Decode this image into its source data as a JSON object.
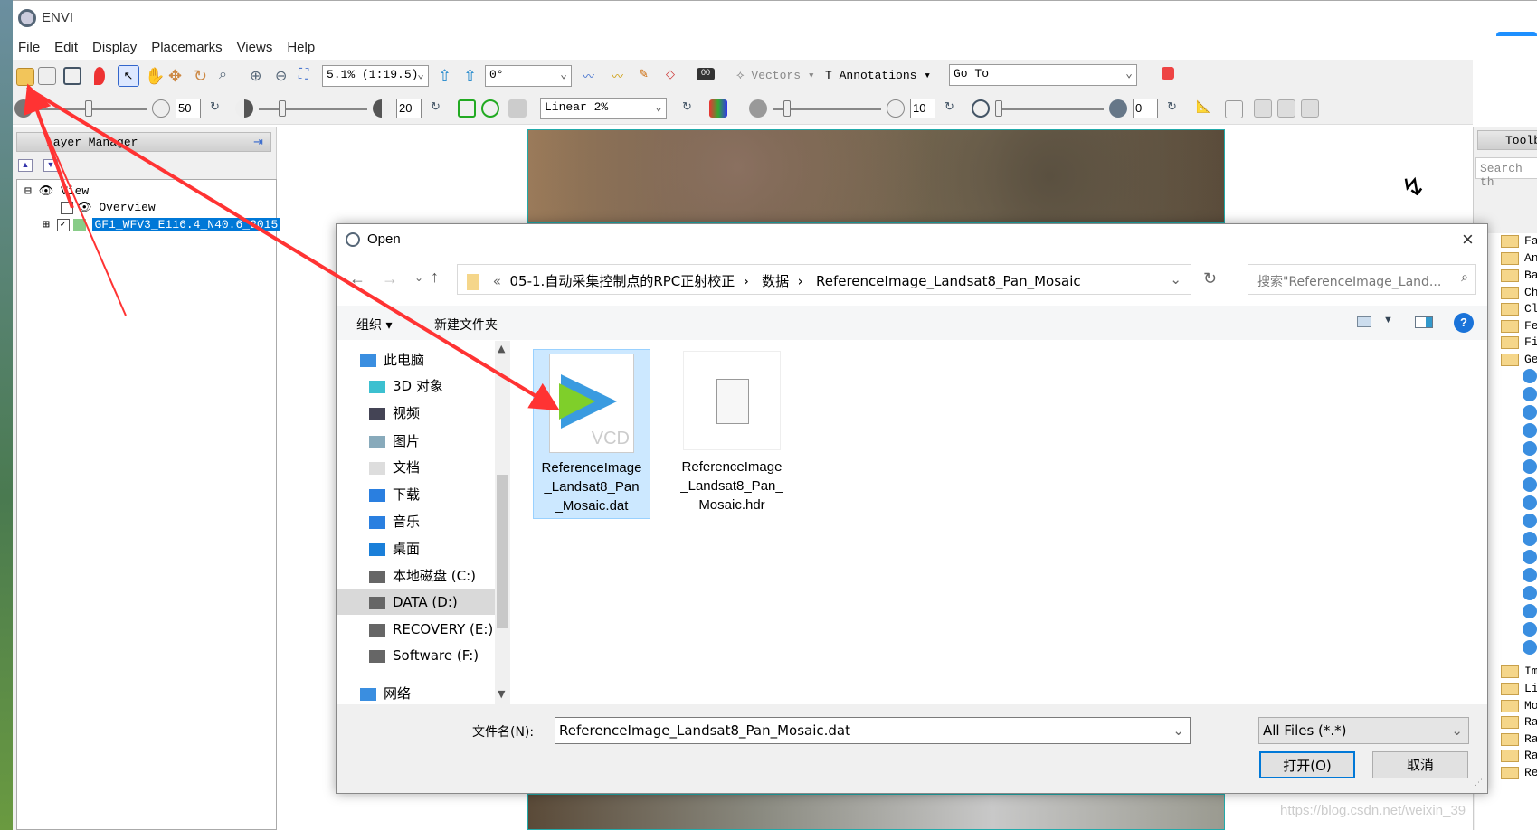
{
  "app": {
    "title": "ENVI",
    "menu": [
      "File",
      "Edit",
      "Display",
      "Placemarks",
      "Views",
      "Help"
    ]
  },
  "toolbar": {
    "zoom_value": "5.1% (1:19.5)",
    "rotation_value": "0°",
    "vectors_label": "Vectors",
    "annotations_label": "Annotations",
    "goto_value": "Go To",
    "brightness": "50",
    "contrast": "20",
    "stretch_value": "Linear 2%",
    "sharpen": "10",
    "transparency": "0"
  },
  "layer_manager": {
    "title": "Layer Manager",
    "tree": {
      "root": "View",
      "items": [
        {
          "label": "Overview",
          "checked": false
        },
        {
          "label": "GF1_WFV3_E116.4_N40.6_2015",
          "checked": true,
          "selected": true
        }
      ]
    }
  },
  "toolbox": {
    "title": "Toolb",
    "search_placeholder": "Search th",
    "items": [
      "Fa",
      "An",
      "Ba",
      "Ch",
      "Cl",
      "Fe",
      "Fi",
      "Ge",
      "Im",
      "Li",
      "Mo",
      "Ra",
      "Ra",
      "Ra",
      "Re"
    ]
  },
  "dialog": {
    "title": "Open",
    "breadcrumb": [
      "«",
      "05-1.自动采集控制点的RPC正射校正",
      "数据",
      "ReferenceImage_Landsat8_Pan_Mosaic"
    ],
    "search_placeholder": "搜索\"ReferenceImage_Land...",
    "organize_label": "组织 ▾",
    "new_folder_label": "新建文件夹",
    "nav_items": [
      {
        "label": "此电脑",
        "icon": "computer-icon"
      },
      {
        "label": "3D 对象",
        "icon": "cube-icon"
      },
      {
        "label": "视频",
        "icon": "video-icon"
      },
      {
        "label": "图片",
        "icon": "picture-icon"
      },
      {
        "label": "文档",
        "icon": "document-icon"
      },
      {
        "label": "下载",
        "icon": "download-icon"
      },
      {
        "label": "音乐",
        "icon": "music-icon"
      },
      {
        "label": "桌面",
        "icon": "desktop-icon"
      },
      {
        "label": "本地磁盘 (C:)",
        "icon": "drive-icon"
      },
      {
        "label": "DATA (D:)",
        "icon": "drive-icon",
        "selected": true
      },
      {
        "label": "RECOVERY (E:)",
        "icon": "drive-icon"
      },
      {
        "label": "Software (F:)",
        "icon": "drive-icon"
      },
      {
        "label": "网络",
        "icon": "network-icon"
      }
    ],
    "files": [
      {
        "name": "ReferenceImage_Landsat8_Pan_Mosaic.dat",
        "badge": "VCD",
        "selected": true
      },
      {
        "name": "ReferenceImage_Landsat8_Pan_Mosaic.hdr",
        "selected": false
      }
    ],
    "filename_label": "文件名(N):",
    "filename_value": "ReferenceImage_Landsat8_Pan_Mosaic.dat",
    "filter_value": "All Files (*.*)",
    "open_label": "打开(O)",
    "cancel_label": "取消"
  },
  "watermark": "https://blog.csdn.net/weixin_39",
  "colors": {
    "selection": "#0078d7",
    "annotation_arrow": "#ff3333",
    "file_selected_bg": "#cce8ff"
  }
}
